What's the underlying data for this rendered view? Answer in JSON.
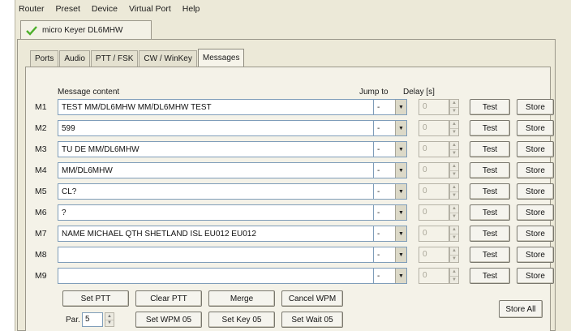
{
  "menubar": {
    "items": [
      "Router",
      "Preset",
      "Device",
      "Virtual Port",
      "Help"
    ]
  },
  "top_tab": {
    "label": "micro Keyer DL6MHW"
  },
  "inner_tabs": [
    "Ports",
    "Audio",
    "PTT / FSK",
    "CW / WinKey",
    "Messages"
  ],
  "headers": {
    "message_content": "Message content",
    "jump_to": "Jump to",
    "delay": "Delay [s]"
  },
  "messages": [
    {
      "label": "M1",
      "content": "TEST MM/DL6MHW MM/DL6MHW TEST",
      "jump": "-",
      "delay": "0"
    },
    {
      "label": "M2",
      "content": "599",
      "jump": "-",
      "delay": "0"
    },
    {
      "label": "M3",
      "content": "TU DE MM/DL6MHW",
      "jump": "-",
      "delay": "0"
    },
    {
      "label": "M4",
      "content": "MM/DL6MHW",
      "jump": "-",
      "delay": "0"
    },
    {
      "label": "M5",
      "content": "CL?",
      "jump": "-",
      "delay": "0"
    },
    {
      "label": "M6",
      "content": "?",
      "jump": "-",
      "delay": "0"
    },
    {
      "label": "M7",
      "content": "NAME MICHAEL QTH SHETLAND ISL EU012 EU012",
      "jump": "-",
      "delay": "0"
    },
    {
      "label": "M8",
      "content": "",
      "jump": "-",
      "delay": "0"
    },
    {
      "label": "M9",
      "content": "",
      "jump": "-",
      "delay": "0"
    }
  ],
  "row_buttons": {
    "test": "Test",
    "store": "Store"
  },
  "bottom": {
    "set_ptt": "Set PTT",
    "clear_ptt": "Clear PTT",
    "merge": "Merge",
    "cancel_wpm": "Cancel WPM",
    "par_label": "Par.",
    "par_value": "5",
    "set_wpm": "Set WPM 05",
    "set_key": "Set Key 05",
    "set_wait": "Set Wait 05",
    "store_all": "Store All"
  },
  "colors": {
    "window_bg": "#ece9d8",
    "panel_bg": "#f4f2e8",
    "check": "#4caf2a"
  }
}
